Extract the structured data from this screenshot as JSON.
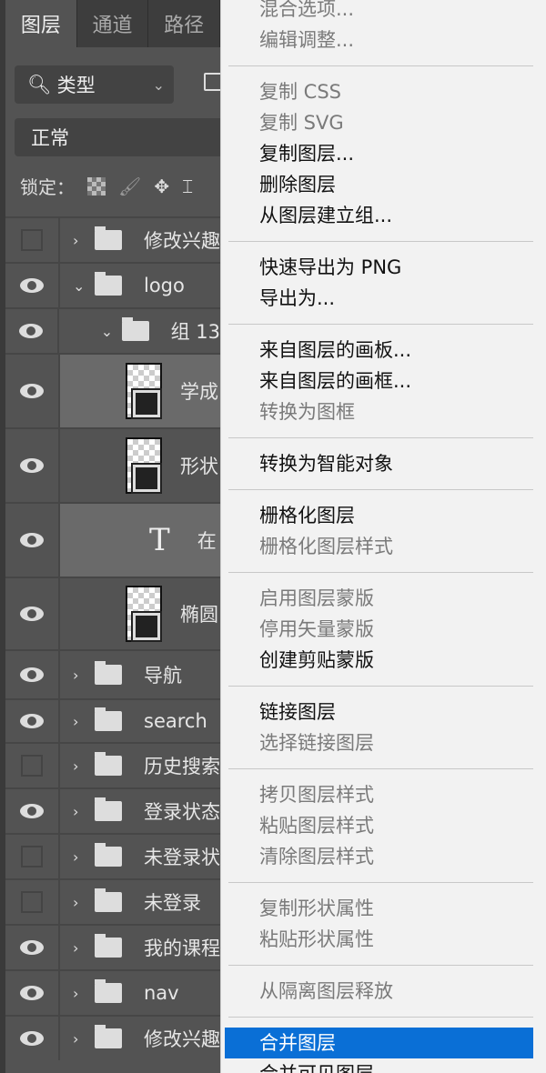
{
  "tabs": [
    "图层",
    "通道",
    "路径"
  ],
  "filter": {
    "label": "类型"
  },
  "blend_mode": "正常",
  "lock_label": "锁定：",
  "layers": [
    {
      "name": "修改兴趣",
      "visible": false,
      "type": "group-collapsed"
    },
    {
      "name": "logo",
      "visible": true,
      "type": "group-expanded"
    },
    {
      "name": "组 13",
      "visible": true,
      "type": "group-expanded"
    },
    {
      "name": "学成",
      "visible": true,
      "type": "shape",
      "selected": true
    },
    {
      "name": "形状",
      "visible": true,
      "type": "shape"
    },
    {
      "name": "在",
      "visible": true,
      "type": "text",
      "selected": true
    },
    {
      "name": "椭圆",
      "visible": true,
      "type": "shape"
    },
    {
      "name": "导航",
      "visible": true,
      "type": "group-collapsed"
    },
    {
      "name": "search",
      "visible": true,
      "type": "group-collapsed"
    },
    {
      "name": "历史搜索",
      "visible": false,
      "type": "group-collapsed"
    },
    {
      "name": "登录状态",
      "visible": true,
      "type": "group-collapsed"
    },
    {
      "name": "未登录状",
      "visible": false,
      "type": "group-collapsed"
    },
    {
      "name": "未登录",
      "visible": false,
      "type": "group-collapsed"
    },
    {
      "name": "我的课程",
      "visible": true,
      "type": "group-collapsed"
    },
    {
      "name": "nav",
      "visible": true,
      "type": "group-collapsed"
    },
    {
      "name": "修改兴趣",
      "visible": true,
      "type": "group-collapsed"
    }
  ],
  "menu": [
    [
      {
        "label": "混合选项...",
        "enabled": false
      },
      {
        "label": "编辑调整...",
        "enabled": false
      }
    ],
    [
      {
        "label": "复制 CSS",
        "enabled": false
      },
      {
        "label": "复制 SVG",
        "enabled": false
      },
      {
        "label": "复制图层...",
        "enabled": true
      },
      {
        "label": "删除图层",
        "enabled": true
      },
      {
        "label": "从图层建立组...",
        "enabled": true
      }
    ],
    [
      {
        "label": "快速导出为 PNG",
        "enabled": true
      },
      {
        "label": "导出为...",
        "enabled": true
      }
    ],
    [
      {
        "label": "来自图层的画板...",
        "enabled": true
      },
      {
        "label": "来自图层的画框...",
        "enabled": true
      },
      {
        "label": "转换为图框",
        "enabled": false
      }
    ],
    [
      {
        "label": "转换为智能对象",
        "enabled": true
      }
    ],
    [
      {
        "label": "栅格化图层",
        "enabled": true
      },
      {
        "label": "栅格化图层样式",
        "enabled": false
      }
    ],
    [
      {
        "label": "启用图层蒙版",
        "enabled": false
      },
      {
        "label": "停用矢量蒙版",
        "enabled": false
      },
      {
        "label": "创建剪贴蒙版",
        "enabled": true
      }
    ],
    [
      {
        "label": "链接图层",
        "enabled": true
      },
      {
        "label": "选择链接图层",
        "enabled": false
      }
    ],
    [
      {
        "label": "拷贝图层样式",
        "enabled": false
      },
      {
        "label": "粘贴图层样式",
        "enabled": false
      },
      {
        "label": "清除图层样式",
        "enabled": false
      }
    ],
    [
      {
        "label": "复制形状属性",
        "enabled": false
      },
      {
        "label": "粘贴形状属性",
        "enabled": false
      }
    ],
    [
      {
        "label": "从隔离图层释放",
        "enabled": false
      }
    ],
    [
      {
        "label": "合并图层",
        "enabled": true,
        "highlighted": true
      },
      {
        "label": "合并可见图层",
        "enabled": true
      }
    ]
  ],
  "colors": {
    "highlight": "#0a6fd6",
    "panel": "#535353"
  }
}
